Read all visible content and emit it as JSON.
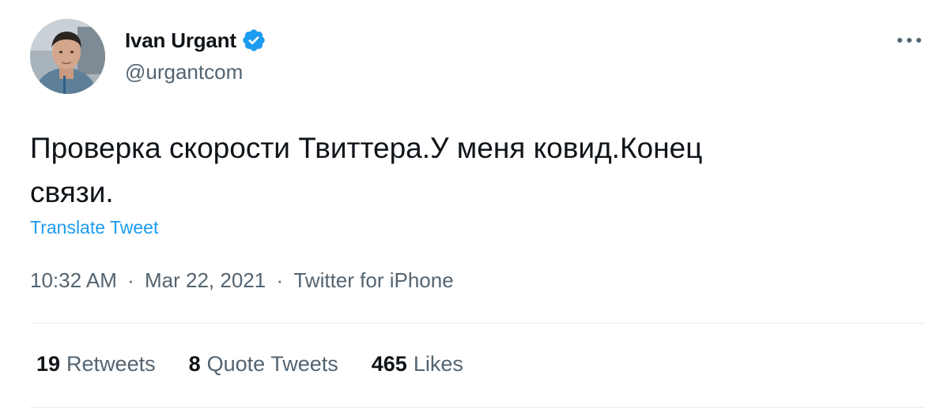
{
  "author": {
    "display_name": "Ivan Urgant",
    "handle": "@urgantcom",
    "verified": true
  },
  "tweet": {
    "text_line1": "Проверка скорости Твиттера.У меня ковид.Конец",
    "text_line2": "связи.",
    "translate_label": "Translate Tweet",
    "time": "10:32 AM",
    "date": "Mar 22, 2021",
    "source": "Twitter for iPhone",
    "separator": "·"
  },
  "stats": [
    {
      "count": "19",
      "label": "Retweets"
    },
    {
      "count": "8",
      "label": "Quote Tweets"
    },
    {
      "count": "465",
      "label": "Likes"
    }
  ],
  "icons": {
    "verified": "verified-badge-icon",
    "more": "more-horizontal-icon"
  },
  "colors": {
    "accent": "#1d9bf0",
    "text_primary": "#0f1419",
    "text_secondary": "#536471",
    "divider": "#e6ecf0"
  }
}
